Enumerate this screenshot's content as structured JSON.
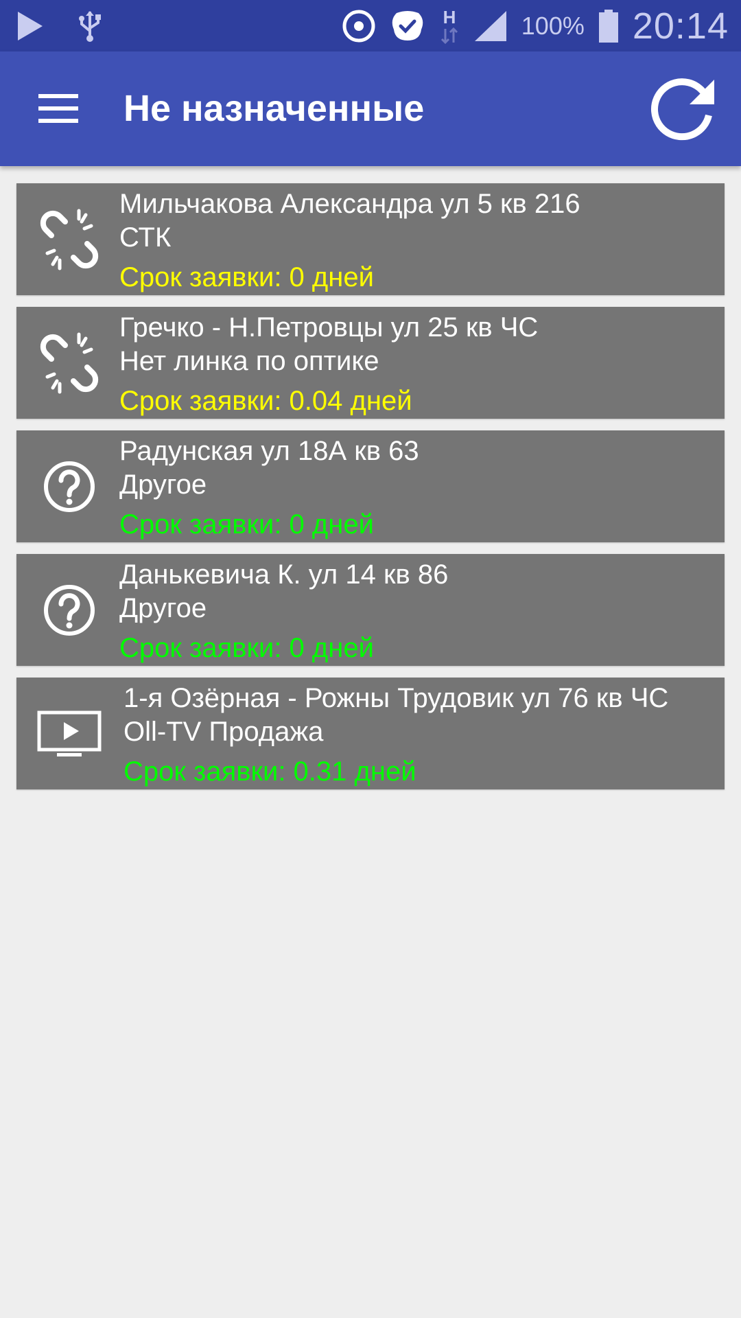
{
  "status_bar": {
    "icons": [
      "play-icon",
      "usb-icon",
      "record-icon",
      "skype-icon",
      "network-h-icon",
      "signal-icon",
      "battery-icon"
    ],
    "battery": "100%",
    "time": "20:14"
  },
  "app_bar": {
    "title": "Не назначенные",
    "menu_icon": "menu-icon",
    "refresh_icon": "refresh-icon"
  },
  "colors": {
    "status_bar": "#2f3f9e",
    "app_bar": "#3f51b5",
    "card": "#757575",
    "due_yellow": "#ffff00",
    "due_green": "#00ff00"
  },
  "items": [
    {
      "icon": "broken-link-icon",
      "address": "Мильчакова Александра ул 5 кв 216",
      "type": "СТК",
      "due": "Срок заявки: 0 дней",
      "due_color": "#ffff00"
    },
    {
      "icon": "broken-link-icon",
      "address": "Гречко - Н.Петровцы ул 25 кв ЧС",
      "type": "Нет линка по оптике",
      "due": "Срок заявки: 0.04 дней",
      "due_color": "#ffff00"
    },
    {
      "icon": "question-icon",
      "address": "Радунская ул 18А кв 63",
      "type": "Другое",
      "due": "Срок заявки: 0 дней",
      "due_color": "#00ff00"
    },
    {
      "icon": "question-icon",
      "address": "Данькевича К. ул 14 кв 86",
      "type": "Другое",
      "due": "Срок заявки: 0 дней",
      "due_color": "#00ff00"
    },
    {
      "icon": "tv-icon",
      "address": "1-я Озёрная - Рожны Трудовик ул 76 кв ЧС",
      "type": "Oll-TV Продажа",
      "due": "Срок заявки: 0.31 дней",
      "due_color": "#00ff00"
    }
  ]
}
